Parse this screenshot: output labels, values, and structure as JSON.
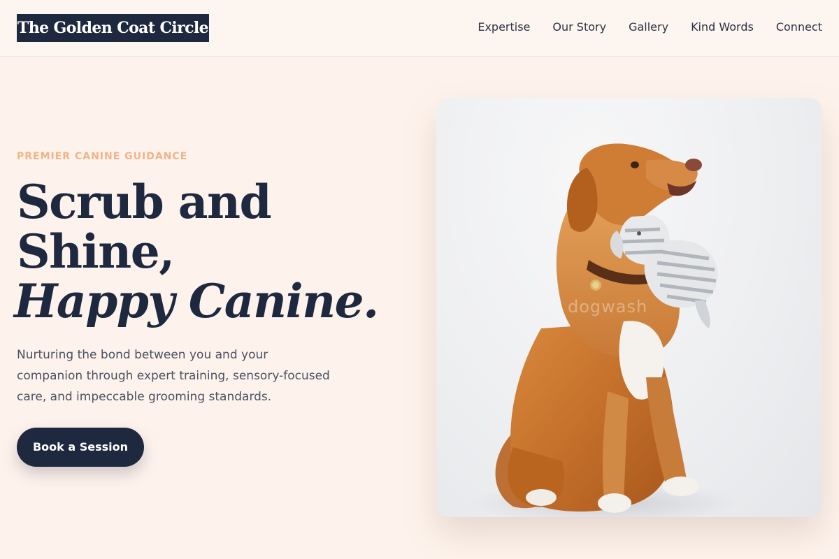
{
  "brand": {
    "name": "The Golden Coat Circle"
  },
  "nav": {
    "items": [
      {
        "label": "Expertise"
      },
      {
        "label": "Our Story"
      },
      {
        "label": "Gallery"
      },
      {
        "label": "Kind Words"
      },
      {
        "label": "Connect"
      }
    ]
  },
  "hero": {
    "eyebrow": "PREMIER CANINE GUIDANCE",
    "headline_line1": "Scrub and",
    "headline_line2": "Shine,",
    "headline_line3": "Happy Canine.",
    "lede": "Nurturing the bond between you and your companion through expert training, sensory-focused care, and impeccable grooming standards.",
    "cta_label": "Book a Session",
    "photo_watermark": "dogwash"
  },
  "colors": {
    "background": "#fef3ec",
    "navy": "#1e2940",
    "accent": "#f0b48a",
    "body_text": "#4a5163"
  }
}
